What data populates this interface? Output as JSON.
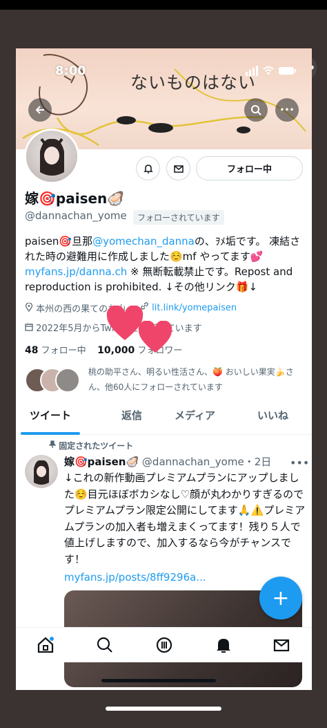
{
  "status_bar": {
    "time": "8:00"
  },
  "banner": {
    "text": "ないものはない"
  },
  "profile": {
    "display_name": "嫁🎯paisen🦪",
    "handle": "@dannachan_yome",
    "follows_you": "フォローされています",
    "follow_button": "フォロー中",
    "bio_line1_pre": "paisen🎯旦那",
    "bio_mention": "@yomechan_danna",
    "bio_line1_post": "の、ｦﾒ垢です。 凍結された時の避難用に作成しました☺️mf やってます💕",
    "bio_link": "myfans.jp/danna.ch",
    "bio_line3": "※ 無断転載禁止です。Repost and reproduction is prohibited. ↓その他リンク🎁↓",
    "location": "本州の西の果てのお山",
    "website": "lit.link/yomepaisen",
    "joined": "2022年5月からTwitterを利用しています",
    "following_count": "48",
    "following_label": "フォロー中",
    "followers_count": "10,000",
    "followers_label": "フォロワー",
    "followed_by_text": "桃の助平さん、明るい性活さん、🍑 おいしい果実🍌さん、他60人にフォローされています"
  },
  "tabs": [
    "ツイート",
    "返信",
    "メディア",
    "いいね"
  ],
  "pinned_tweet": {
    "pinned_label": "固定されたツイート",
    "name": "嫁🎯paisen🦪",
    "handle_time": "@dannachan_yome・2日",
    "body": "↓これの新作動画プレミアムプランにアップしました☺️目元ほぼボカシなし♡顔が丸わかりすぎるのでプレミアムプラン限定公開にしてます🙏⚠️プレミアムプランの加入者も増えまくってます！残り５人で値上げしますので、加入するなら今がチャンスです！",
    "link": "myfans.jp/posts/8ff9296a..."
  },
  "fab_label": "+",
  "nav_icons": [
    "home-icon",
    "search-icon",
    "spaces-icon",
    "bell-icon",
    "mail-icon"
  ],
  "colors": {
    "accent": "#1d9bf0",
    "heart": "#f0456a"
  }
}
